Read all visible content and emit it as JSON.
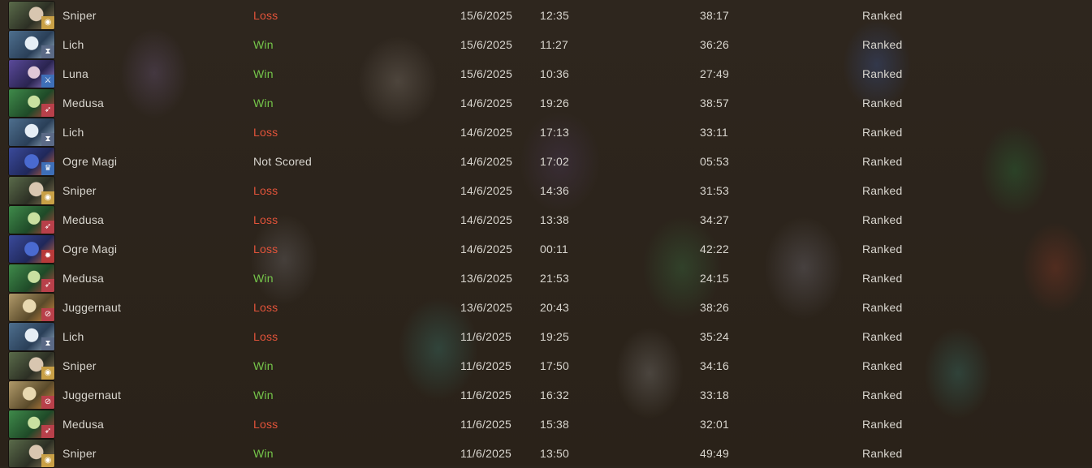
{
  "colors": {
    "win": "#75c64a",
    "loss": "#e2533a",
    "not_scored": "#d9d6cf",
    "text": "#d9d6cf",
    "background": "#2b241c"
  },
  "matches": [
    {
      "hero": "Sniper",
      "result": "Loss",
      "date": "15/6/2025",
      "time": "12:35",
      "duration": "38:17",
      "mode": "Ranked",
      "portrait": "sniper-portrait",
      "role_icon": "eye-icon"
    },
    {
      "hero": "Lich",
      "result": "Win",
      "date": "15/6/2025",
      "time": "11:27",
      "duration": "36:26",
      "mode": "Ranked",
      "portrait": "lich-portrait",
      "role_icon": "hourglass-icon"
    },
    {
      "hero": "Luna",
      "result": "Win",
      "date": "15/6/2025",
      "time": "10:36",
      "duration": "27:49",
      "mode": "Ranked",
      "portrait": "luna-portrait",
      "role_icon": "sword-icon"
    },
    {
      "hero": "Medusa",
      "result": "Win",
      "date": "14/6/2025",
      "time": "19:26",
      "duration": "38:57",
      "mode": "Ranked",
      "portrait": "medusa-portrait",
      "role_icon": "bow-icon"
    },
    {
      "hero": "Lich",
      "result": "Loss",
      "date": "14/6/2025",
      "time": "17:13",
      "duration": "33:11",
      "mode": "Ranked",
      "portrait": "lich-portrait",
      "role_icon": "hourglass-icon"
    },
    {
      "hero": "Ogre Magi",
      "result": "Not Scored",
      "date": "14/6/2025",
      "time": "17:02",
      "duration": "05:53",
      "mode": "Ranked",
      "portrait": "ogre-magi-portrait",
      "role_icon": "crown-icon"
    },
    {
      "hero": "Sniper",
      "result": "Loss",
      "date": "14/6/2025",
      "time": "14:36",
      "duration": "31:53",
      "mode": "Ranked",
      "portrait": "sniper-portrait",
      "role_icon": "eye-icon"
    },
    {
      "hero": "Medusa",
      "result": "Loss",
      "date": "14/6/2025",
      "time": "13:38",
      "duration": "34:27",
      "mode": "Ranked",
      "portrait": "medusa-portrait",
      "role_icon": "bow-icon"
    },
    {
      "hero": "Ogre Magi",
      "result": "Loss",
      "date": "14/6/2025",
      "time": "00:11",
      "duration": "42:22",
      "mode": "Ranked",
      "portrait": "ogre-magi-portrait",
      "role_icon": "skull-icon"
    },
    {
      "hero": "Medusa",
      "result": "Win",
      "date": "13/6/2025",
      "time": "21:53",
      "duration": "24:15",
      "mode": "Ranked",
      "portrait": "medusa-portrait",
      "role_icon": "bow-icon"
    },
    {
      "hero": "Juggernaut",
      "result": "Loss",
      "date": "13/6/2025",
      "time": "20:43",
      "duration": "38:26",
      "mode": "Ranked",
      "portrait": "juggernaut-portrait",
      "role_icon": "slash-icon"
    },
    {
      "hero": "Lich",
      "result": "Loss",
      "date": "11/6/2025",
      "time": "19:25",
      "duration": "35:24",
      "mode": "Ranked",
      "portrait": "lich-portrait",
      "role_icon": "hourglass-icon"
    },
    {
      "hero": "Sniper",
      "result": "Win",
      "date": "11/6/2025",
      "time": "17:50",
      "duration": "34:16",
      "mode": "Ranked",
      "portrait": "sniper-portrait",
      "role_icon": "eye-icon"
    },
    {
      "hero": "Juggernaut",
      "result": "Win",
      "date": "11/6/2025",
      "time": "16:32",
      "duration": "33:18",
      "mode": "Ranked",
      "portrait": "juggernaut-portrait",
      "role_icon": "slash-icon"
    },
    {
      "hero": "Medusa",
      "result": "Loss",
      "date": "11/6/2025",
      "time": "15:38",
      "duration": "32:01",
      "mode": "Ranked",
      "portrait": "medusa-portrait",
      "role_icon": "bow-icon"
    },
    {
      "hero": "Sniper",
      "result": "Win",
      "date": "11/6/2025",
      "time": "13:50",
      "duration": "49:49",
      "mode": "Ranked",
      "portrait": "sniper-portrait",
      "role_icon": "eye-icon"
    }
  ]
}
